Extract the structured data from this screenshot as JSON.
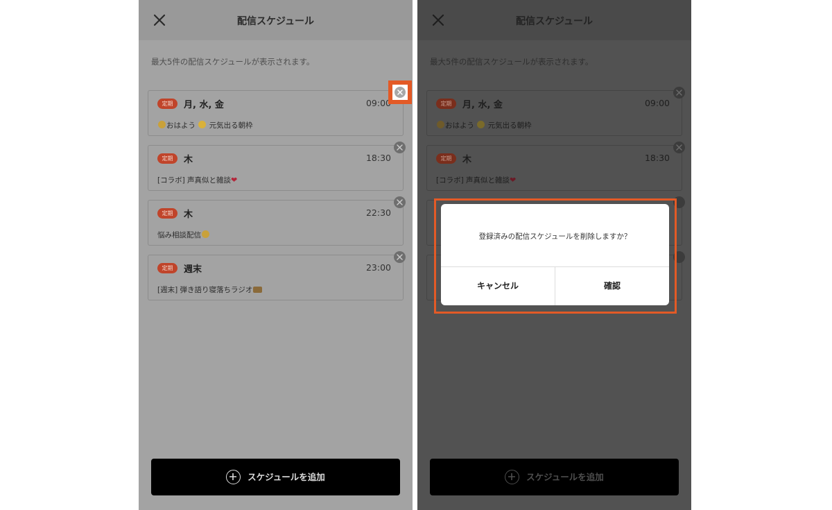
{
  "header": {
    "title": "配信スケジュール"
  },
  "note": "最大5件の配信スケジュールが表示されます。",
  "schedules": [
    {
      "badge": "定期",
      "days": "月, 水, 金",
      "time": "09:00",
      "title_prefix": "おはよう",
      "title_main": "元気出る朝枠"
    },
    {
      "badge": "定期",
      "days": "木",
      "time": "18:30",
      "title_main": "[コラボ] 声真似と雑談"
    },
    {
      "badge": "定期",
      "days": "木",
      "time": "22:30",
      "title_main": "悩み相談配信"
    },
    {
      "badge": "定期",
      "days": "週末",
      "time": "23:00",
      "title_main": "[週末] 弾き語り寝落ちラジオ"
    }
  ],
  "add_button": {
    "label": "スケジュールを追加"
  },
  "dialog": {
    "message": "登録済みの配信スケジュールを削除しますか？",
    "cancel_label": "キャンセル",
    "confirm_label": "確認"
  },
  "colors": {
    "badge": "#c0442a",
    "highlight": "#e35a26",
    "add_button_bg": "#000000"
  },
  "icons": {
    "close": "close-icon",
    "delete": "circle-x-icon",
    "add": "plus-circle-icon",
    "heart": "heart-icon",
    "emoji": "emoji-icon",
    "radio": "radio-icon"
  }
}
